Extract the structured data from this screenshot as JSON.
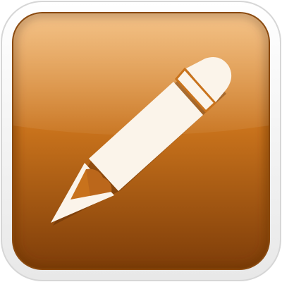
{
  "icon": {
    "name": "pencil-icon",
    "colors": {
      "frame": "#f2f2f2",
      "frame_edge": "#d9d9d9",
      "tile_top": "#eea248",
      "tile_mid": "#c9731c",
      "tile_bottom": "#7e3d09",
      "pencil": "#fbf4ea",
      "pencil_shadow": "#c9bfb3"
    }
  }
}
